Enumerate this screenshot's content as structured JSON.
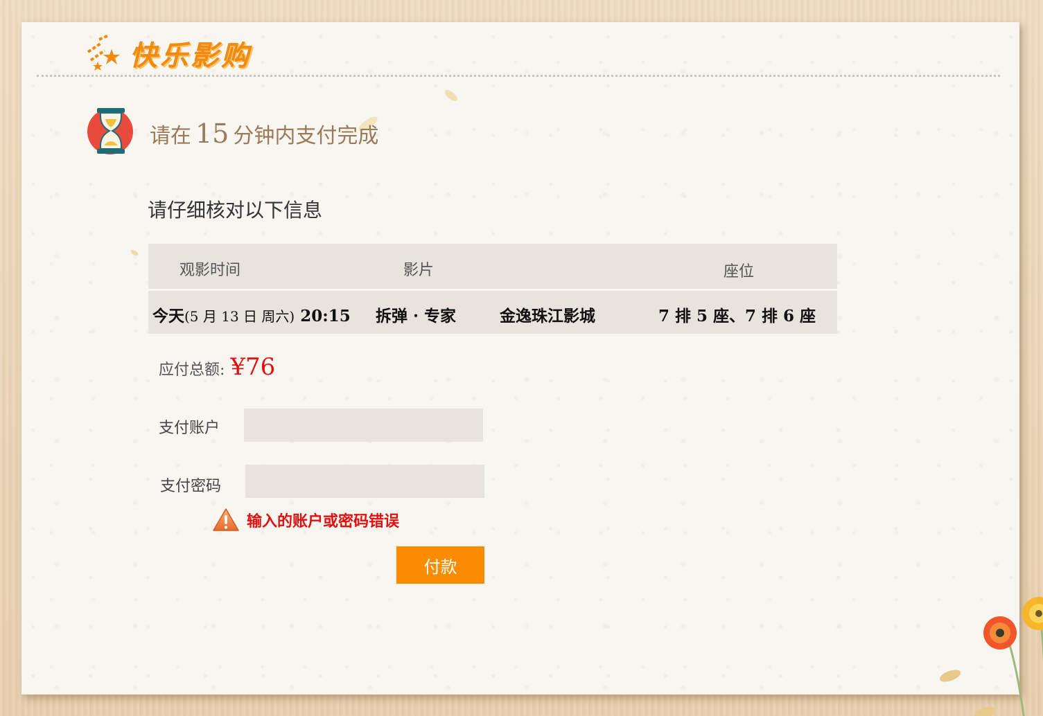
{
  "header": {
    "logo_text": "快乐影购",
    "logo_icon": "sparkle-stars-icon"
  },
  "timer": {
    "prefix": "请在",
    "minutes": "15",
    "suffix": "分钟内支付完成",
    "icon": "hourglass-icon"
  },
  "verify": {
    "title": "请仔细核对以下信息"
  },
  "table": {
    "headers": [
      "观影时间",
      "影片",
      "座位"
    ],
    "row": {
      "day": "今天",
      "date_detail": "(5 月 13 日  周六)",
      "time": "20:15",
      "movie": "拆弹 · 专家",
      "cinema": "金逸珠江影城",
      "seats": "7 排 5 座、7 排 6 座"
    }
  },
  "total": {
    "label": "应付总额:",
    "value": "¥76"
  },
  "form": {
    "account_label": "支付账户",
    "account_value": "",
    "password_label": "支付密码",
    "password_value": ""
  },
  "error": {
    "icon": "warning-triangle-icon",
    "message": "输入的账户或密码错误"
  },
  "pay_button": {
    "label": "付款"
  },
  "colors": {
    "accent": "#fb8c00",
    "error": "#e01010",
    "table_bg": "#e8e3dc",
    "paper": "#f8f6f1"
  }
}
